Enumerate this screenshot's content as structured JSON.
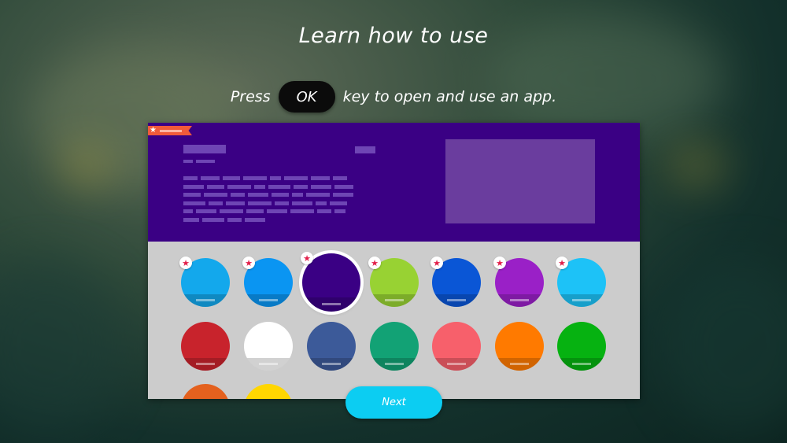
{
  "title": "Learn how to use",
  "instruction": {
    "before": "Press",
    "key": "OK",
    "after": "key to open and use an app."
  },
  "next_button": "Next",
  "icons": {
    "ribbon": "star-ribbon-icon",
    "favorite": "star-icon"
  },
  "colors": {
    "hero_background": "#3a0084",
    "next_button": "#0ccdf2",
    "favorite_star": "#e2204a"
  },
  "apps": [
    [
      {
        "color": "#13a8ec",
        "favorite": true,
        "selected": false
      },
      {
        "color": "#0a95f2",
        "favorite": true,
        "selected": false
      },
      {
        "color": "#3a0084",
        "favorite": true,
        "selected": true
      },
      {
        "color": "#98d233",
        "favorite": true,
        "selected": false
      },
      {
        "color": "#0a56d6",
        "favorite": true,
        "selected": false
      },
      {
        "color": "#9a20c7",
        "favorite": true,
        "selected": false
      },
      {
        "color": "#1dc2f7",
        "favorite": true,
        "selected": false
      }
    ],
    [
      {
        "color": "#c8232c",
        "favorite": false,
        "selected": false
      },
      {
        "color": "#ffffff",
        "favorite": false,
        "selected": false
      },
      {
        "color": "#3c5a99",
        "favorite": false,
        "selected": false
      },
      {
        "color": "#12a275",
        "favorite": false,
        "selected": false
      },
      {
        "color": "#f7606b",
        "favorite": false,
        "selected": false
      },
      {
        "color": "#ff7a00",
        "favorite": false,
        "selected": false
      },
      {
        "color": "#06b211",
        "favorite": false,
        "selected": false
      }
    ],
    [
      {
        "color": "#e4611e",
        "favorite": false,
        "selected": false
      },
      {
        "color": "#ffd600",
        "favorite": false,
        "selected": false
      }
    ]
  ]
}
